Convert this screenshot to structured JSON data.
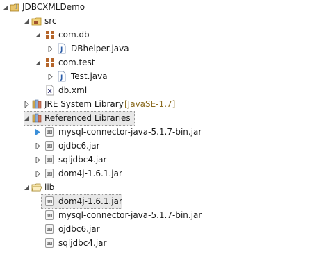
{
  "tree": {
    "project": {
      "label": "JDBCXMLDemo"
    },
    "src": {
      "label": "src"
    },
    "packages": [
      {
        "label": "com.db",
        "files": [
          {
            "label": "DBhelper.java"
          }
        ]
      },
      {
        "label": "com.test",
        "files": [
          {
            "label": "Test.java"
          }
        ]
      }
    ],
    "xml_file": {
      "label": "db.xml"
    },
    "jre": {
      "label": "JRE System Library",
      "decoration": "[JavaSE-1.7]"
    },
    "referenced": {
      "label": "Referenced Libraries",
      "jars": [
        {
          "label": "mysql-connector-java-5.1.7-bin.jar"
        },
        {
          "label": "ojdbc6.jar"
        },
        {
          "label": "sqljdbc4.jar"
        },
        {
          "label": "dom4j-1.6.1.jar"
        }
      ]
    },
    "lib": {
      "label": "lib",
      "files": [
        {
          "label": "dom4j-1.6.1.jar"
        },
        {
          "label": "mysql-connector-java-5.1.7-bin.jar"
        },
        {
          "label": "ojdbc6.jar"
        },
        {
          "label": "sqljdbc4.jar"
        }
      ]
    }
  },
  "icons": {
    "project": "java-project-icon",
    "source_folder": "source-folder-icon",
    "package": "package-icon",
    "java_file": "java-file-icon",
    "xml_file": "xml-file-icon",
    "library": "library-icon",
    "jar": "jar-icon",
    "folder": "folder-icon"
  },
  "colors": {
    "decoration": "#8b6b1f",
    "selection": "#e8e8e8",
    "package_brown": "#a0522d",
    "jar_gray": "#7f7f7f"
  }
}
